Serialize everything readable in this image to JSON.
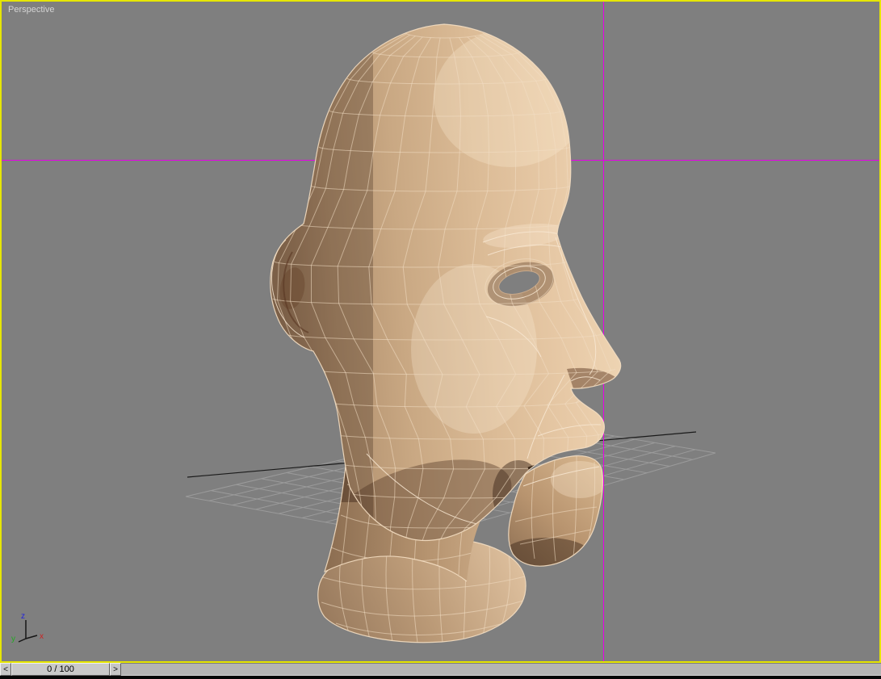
{
  "viewport": {
    "label": "Perspective"
  },
  "tripod": {
    "z": "z",
    "x": "x",
    "y": "y"
  },
  "time_slider": {
    "value": "0 / 100",
    "prev": "<",
    "next": ">"
  },
  "colors": {
    "viewport_bg": "#7f7f7f",
    "active_viewport_border": "#e6e600",
    "crosshair": "#e800e8",
    "grid_line": "#9b9b9b",
    "grid_axis": "#1a1a1a",
    "wireframe": "#f3dec5",
    "model_skin": "#d9b893",
    "axis_x": "#cc2222",
    "axis_y": "#22aa22",
    "axis_z": "#2222dd"
  }
}
